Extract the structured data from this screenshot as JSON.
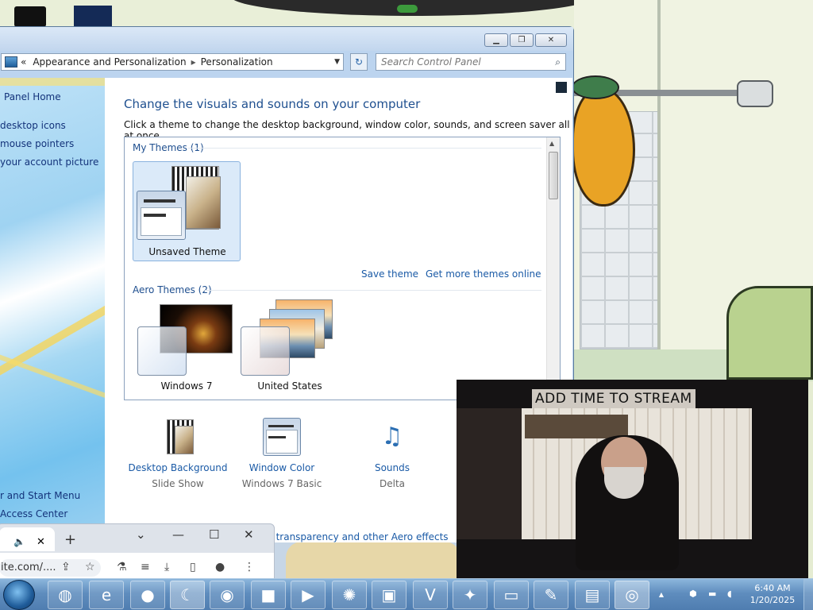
{
  "window": {
    "breadcrumb": [
      "Appearance and Personalization",
      "Personalization"
    ],
    "search_placeholder": "Search Control Panel"
  },
  "nav": {
    "home": "Panel Home",
    "links": [
      "desktop icons",
      "mouse pointers",
      "your account picture"
    ],
    "see_also": [
      "r and Start Menu",
      "Access Center"
    ]
  },
  "main": {
    "title": "Change the visuals and sounds on your computer",
    "subtitle": "Click a theme to change the desktop background, window color, sounds, and screen saver all at once.",
    "my_themes_header": "My Themes (1)",
    "unsaved_theme": "Unsaved Theme",
    "save_theme": "Save theme",
    "get_more_themes": "Get more themes online",
    "aero_themes_header": "Aero Themes (2)",
    "aero_themes": [
      "Windows 7",
      "United States"
    ]
  },
  "bottom": {
    "desktop_background": {
      "label": "Desktop Background",
      "value": "Slide Show"
    },
    "window_color": {
      "label": "Window Color",
      "value": "Windows 7 Basic"
    },
    "sounds": {
      "label": "Sounds",
      "value": "Delta"
    },
    "troubleshoot": "Troubleshoot problems with transparency and other Aero effects"
  },
  "webcam": {
    "banner": "ADD TIME TO STREAM"
  },
  "browser": {
    "url": "ite.com/...."
  },
  "taskbar": {
    "time": "6:40 AM",
    "date": "1/20/2025",
    "apps": [
      "explorer-icon",
      "edge-icon",
      "ie-icon",
      "dark-app-icon",
      "moon-app-icon",
      "steam-icon",
      "dark-box-icon",
      "media-player-icon",
      "blender-icon",
      "recorder-icon",
      "vnc-icon",
      "bird-app-icon",
      "monitor-app-icon",
      "paint-icon",
      "rdp-icon",
      "chrome-icon"
    ]
  }
}
